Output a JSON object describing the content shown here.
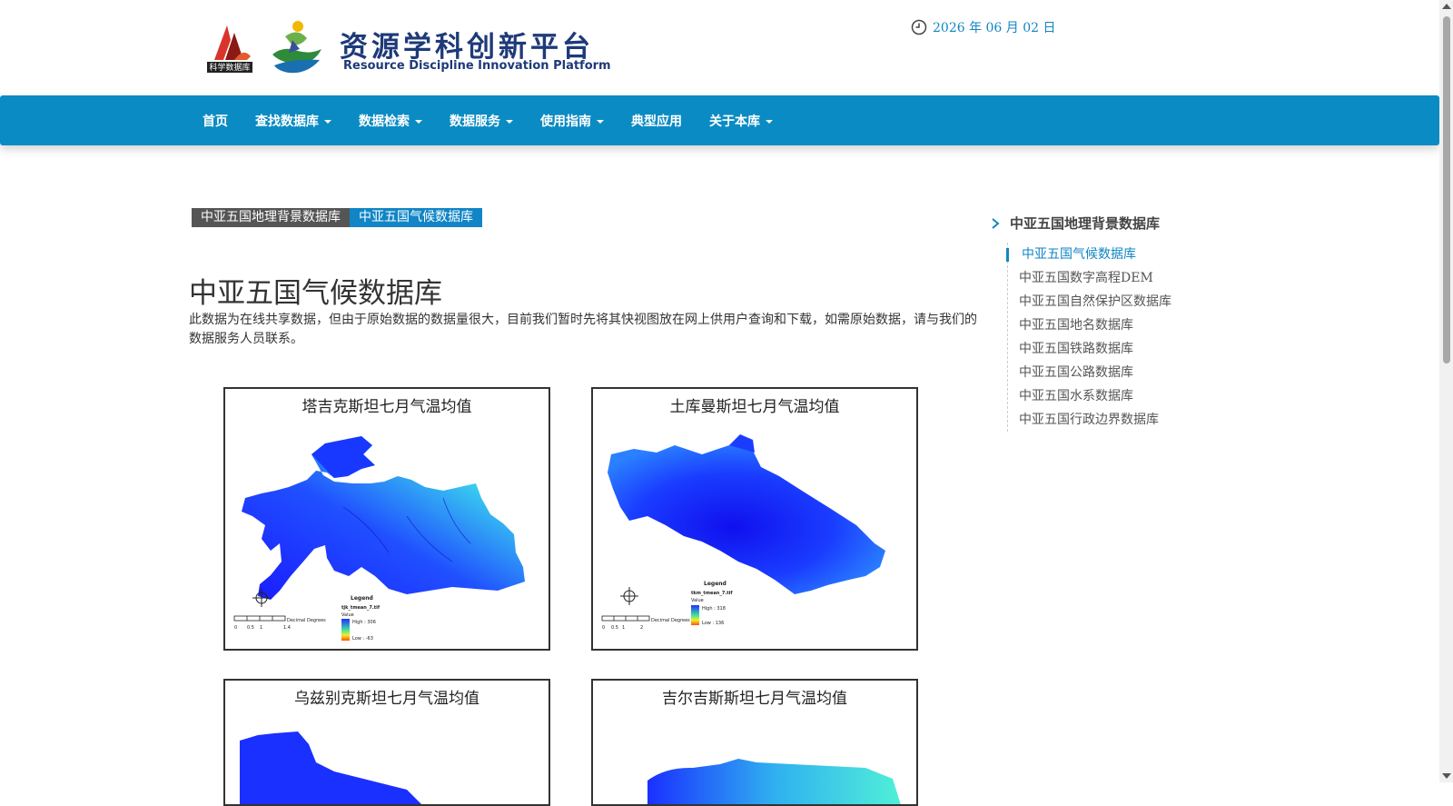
{
  "header": {
    "logo_badge_text": "科学数据库",
    "logo_title": "资源学科创新平台",
    "logo_subtitle": "Resource Discipline Innovation Platform",
    "date": "2026 年 06 月 02 日"
  },
  "nav": {
    "items": [
      {
        "label": "首页",
        "dropdown": false
      },
      {
        "label": "查找数据库",
        "dropdown": true
      },
      {
        "label": "数据检索",
        "dropdown": true
      },
      {
        "label": "数据服务",
        "dropdown": true
      },
      {
        "label": "使用指南",
        "dropdown": true
      },
      {
        "label": "典型应用",
        "dropdown": false
      },
      {
        "label": "关于本库",
        "dropdown": true
      }
    ]
  },
  "breadcrumb": {
    "parent": "中亚五国地理背景数据库",
    "current": "中亚五国气候数据库"
  },
  "main": {
    "title": "中亚五国气候数据库",
    "description": "此数据为在线共享数据，但由于原始数据的数据量很大，目前我们暂时先将其快视图放在网上供用户查询和下载，如需原始数据，请与我们的数据服务人员联系。",
    "maps": [
      {
        "title": "塔吉克斯坦七月气温均值",
        "legend_title": "Legend",
        "file": "tjk_tmean_7.tif",
        "value_label": "Value",
        "high": "High : 306",
        "low": "Low : -63",
        "scale_label": "Decimal Degrees",
        "scale_ticks": [
          "0",
          "0.5",
          "1",
          "1.4"
        ]
      },
      {
        "title": "土库曼斯坦七月气温均值",
        "legend_title": "Legend",
        "file": "tkm_tmean_7.tif",
        "value_label": "Value",
        "high": "High : 318",
        "low": "Low : 136",
        "scale_label": "Decimal Degrees",
        "scale_ticks": [
          "0",
          "0.5",
          "1",
          "2"
        ]
      },
      {
        "title": "乌兹别克斯坦七月气温均值"
      },
      {
        "title": "吉尔吉斯斯坦七月气温均值"
      }
    ]
  },
  "sidebar": {
    "heading": "中亚五国地理背景数据库",
    "items": [
      {
        "label": "中亚五国气候数据库",
        "active": true
      },
      {
        "label": "中亚五国数字高程DEM",
        "active": false
      },
      {
        "label": "中亚五国自然保护区数据库",
        "active": false
      },
      {
        "label": "中亚五国地名数据库",
        "active": false
      },
      {
        "label": "中亚五国铁路数据库",
        "active": false
      },
      {
        "label": "中亚五国公路数据库",
        "active": false
      },
      {
        "label": "中亚五国水系数据库",
        "active": false
      },
      {
        "label": "中亚五国行政边界数据库",
        "active": false
      }
    ]
  },
  "colors": {
    "brand_blue": "#0b8bc3",
    "link_blue": "#1185c5",
    "map_low": "#1a1aff",
    "map_high": "#40f0e0"
  }
}
